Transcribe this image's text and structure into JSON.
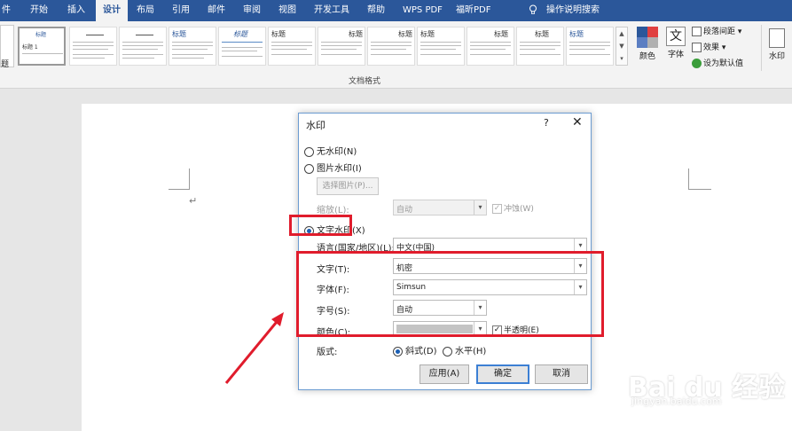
{
  "ribbon_tabs": [
    "件",
    "开始",
    "插入",
    "设计",
    "布局",
    "引用",
    "邮件",
    "审阅",
    "视图",
    "开发工具",
    "帮助",
    "WPS PDF",
    "福昕PDF",
    "操作说明搜索"
  ],
  "ribbon": {
    "themes_label": "题",
    "style_thumb_title": "标题",
    "style_thumb_heading1": "标题 1",
    "group_label": "文档格式",
    "colors_label": "颜色",
    "fonts_label": "字体",
    "fonts_glyph": "文",
    "para_spacing_label": "段落间距",
    "effects_label": "效果",
    "set_default_label": "设为默认值",
    "watermark_label": "水印"
  },
  "dialog": {
    "title": "水印",
    "help": "?",
    "close": "✕",
    "no_watermark": "无水印(N)",
    "picture_watermark": "图片水印(I)",
    "select_picture": "选择图片(P)...",
    "scale_label": "缩放(L):",
    "scale_value": "自动",
    "washout_label": "冲蚀(W)",
    "text_watermark": "文字水印(X)",
    "language_label": "语言(国家/地区)(L):",
    "language_value": "中文(中国)",
    "text_label": "文字(T):",
    "text_value": "机密",
    "font_label": "字体(F):",
    "font_value": "Simsun",
    "size_label": "字号(S):",
    "size_value": "自动",
    "color_label": "颜色(C):",
    "semitransparent_label": "半透明(E)",
    "layout_label": "版式:",
    "diagonal_label": "斜式(D)",
    "horizontal_label": "水平(H)",
    "apply_label": "应用(A)",
    "ok_label": "确定",
    "cancel_label": "取消",
    "selected_option": "text_watermark",
    "semitransparent_checked": true,
    "washout_checked": true,
    "layout_selected": "diagonal"
  },
  "watermark_logo": {
    "main": "Bai du 经验",
    "sub": "jingyan.baidu.com"
  },
  "colors": {
    "ribbon_blue": "#2b579a",
    "highlight_red": "#e01c2c",
    "dialog_border": "#6b9bd1"
  }
}
